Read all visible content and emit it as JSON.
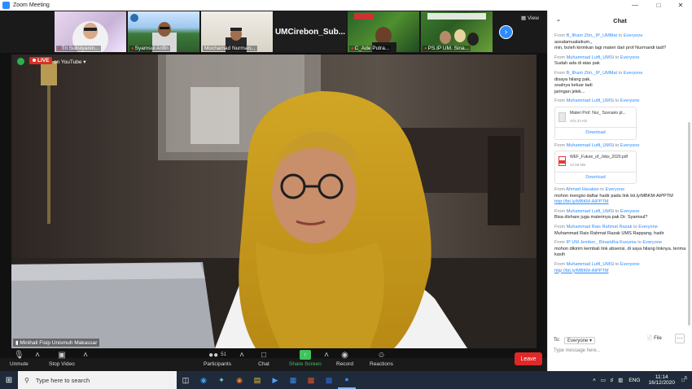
{
  "window": {
    "title": "Zoom Meeting"
  },
  "thumbnails": [
    {
      "name": "Tri Sulistyanin...",
      "muted": true
    },
    {
      "name": "Syamsul Arifin",
      "muted": true
    },
    {
      "name": "Mochamad Nurman...",
      "muted": false
    },
    {
      "name": "UMCirebon_Sub...",
      "muted": false,
      "text_only": true
    },
    {
      "name": "C_Ade Putra...",
      "muted": true
    },
    {
      "name": "PS.IP UM. Sina...",
      "muted": true
    }
  ],
  "view_label": "View",
  "main_video": {
    "live_label": "LIVE",
    "stream_label": "on YouTube",
    "speaker_name": "Minihall Fisip Unismuh Makassar"
  },
  "toolbar": {
    "unmute": "Unmute",
    "stop_video": "Stop Video",
    "participants": "Participants",
    "participants_count": "51",
    "chat": "Chat",
    "share_screen": "Share Screen",
    "record": "Record",
    "reactions": "Reactions",
    "leave": "Leave"
  },
  "chat": {
    "title": "Chat",
    "messages": [
      {
        "from": "B_Ilham Zitri,_IP_UMMat",
        "to": "Everyone",
        "lines": [
          "assalamualaikum,,",
          "min, boleh kirimkan lagi materi dari prof Nurmandi tadi?"
        ]
      },
      {
        "from": "Muhammad Lutfi_UMSi",
        "to": "Everyone",
        "lines": [
          "Sudah ada di atas pak"
        ]
      },
      {
        "from": "B_Ilham Zitri,_IP_UMMat",
        "to": "Everyone",
        "lines": [
          "disaya hilang pak,",
          "soalnya keluar tadi",
          "jaringan jelek..."
        ]
      },
      {
        "from": "Muhammad Lutfi_UMSi",
        "to": "Everyone",
        "file": {
          "name": "Materi Prof. Nur_ Scenario pl...",
          "size": "403.33 KB",
          "download": "Download"
        }
      },
      {
        "from": "Muhammad Lutfi_UMSi",
        "to": "Everyone",
        "file": {
          "name": "WEF_Future_of_Jobs_2020.pdf",
          "size": "10.59 MB",
          "download": "Download"
        }
      },
      {
        "from": "Ahmad Harakan",
        "to": "Everyone",
        "lines": [
          "mohon mengisi daftar hadir pada link bit.ly/MBKM-AIPPTM"
        ],
        "link": "http://bit.ly/MBKM-AIPPTM"
      },
      {
        "from": "Muhammad Lutfi_UMSi",
        "to": "Everyone",
        "lines": [
          "Bisa dishare juga materinya pak Dr. Syamsul?"
        ]
      },
      {
        "from": "Muhammad Rais Rahmat Razak",
        "to": "Everyone",
        "lines": [
          "Muhammad Rais Rahmat Razak UMS Rappang, hadir"
        ]
      },
      {
        "from": "IP UM Jember_ Binaridha Kusuma",
        "to": "Everyone",
        "lines": [
          "mohon dikirim kembali link absensi, di saya hilang linknya. terima kasih"
        ]
      },
      {
        "from": "Muhammad Lutfi_UMSi",
        "to": "Everyone",
        "lines": [],
        "link": "http://bit.ly/MBKM-AIPPTM"
      }
    ],
    "to_label": "To:",
    "to_value": "Everyone",
    "file_label": "File",
    "placeholder": "Type message here..."
  },
  "taskbar": {
    "search_placeholder": "Type here to search",
    "language": "ENG",
    "time": "11:14",
    "date": "16/12/2020",
    "notifications": "5"
  },
  "colors": {
    "accent": "#2d8cff",
    "leave": "#e02828",
    "live": "#d93025",
    "taskbar": "#1f2b3a"
  }
}
